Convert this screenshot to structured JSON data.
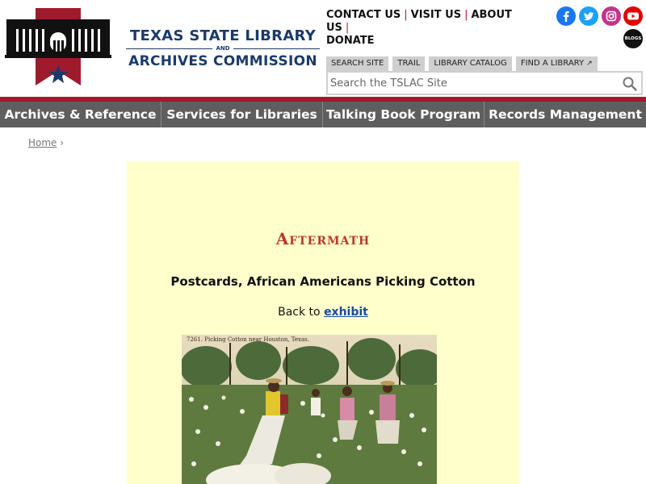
{
  "header": {
    "logo": {
      "line1": "TEXAS STATE LIBRARY",
      "and": "AND",
      "line2": "ARCHIVES COMMISSION"
    },
    "toplinks": [
      {
        "label": "CONTACT US"
      },
      {
        "label": "VISIT US"
      },
      {
        "label": "ABOUT US"
      },
      {
        "label": "DONATE"
      }
    ],
    "social": [
      {
        "icon": "facebook-icon"
      },
      {
        "icon": "twitter-icon"
      },
      {
        "icon": "instagram-icon"
      },
      {
        "icon": "youtube-icon"
      },
      {
        "icon": "blogs-icon",
        "label": "BLOGS"
      }
    ],
    "search_tabs": [
      {
        "label": "SEARCH SITE"
      },
      {
        "label": "TRAIL"
      },
      {
        "label": "LIBRARY CATALOG"
      },
      {
        "label": "FIND A LIBRARY"
      }
    ],
    "search": {
      "placeholder": "Search the TSLAC Site"
    }
  },
  "nav": {
    "items": [
      {
        "label": "Archives & Reference"
      },
      {
        "label": "Services for Libraries"
      },
      {
        "label": "Talking Book Program"
      },
      {
        "label": "Records Management"
      }
    ]
  },
  "breadcrumb": {
    "home": "Home",
    "separator": "›"
  },
  "main": {
    "section_heading": "Aftermath",
    "title": "Postcards, African Americans Picking Cotton",
    "back_prefix": "Back to",
    "back_link": "exhibit",
    "postcard_caption": "7261.  Picking Cotton near Houston, Texas."
  },
  "colors": {
    "brand_red": "#9e1b2e",
    "brand_blue": "#1b3a6b",
    "nav_bg": "#5e5e5e",
    "panel_bg": "#ffffcc",
    "link_blue": "#1a4aa0"
  }
}
